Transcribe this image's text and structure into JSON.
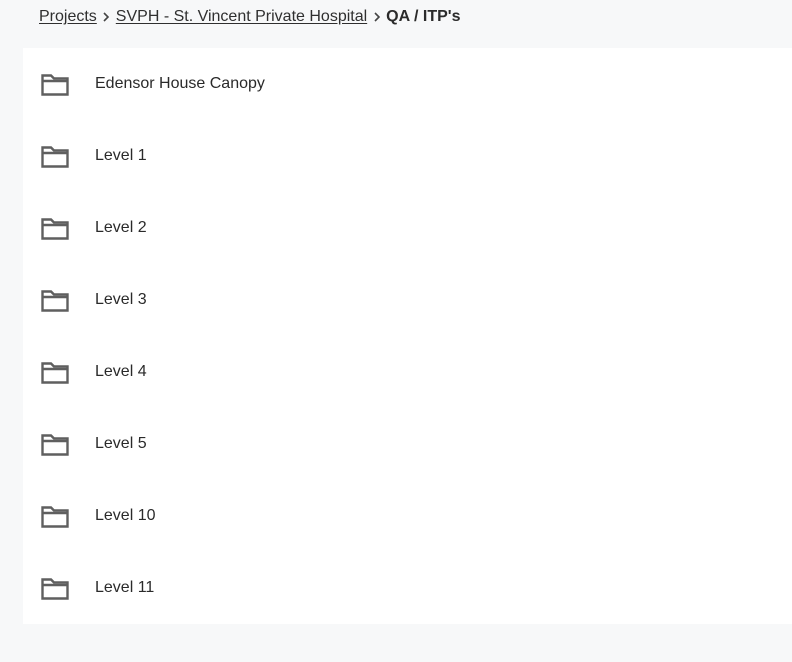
{
  "breadcrumb": {
    "items": [
      {
        "label": "Projects"
      },
      {
        "label": "SVPH - St. Vincent Private Hospital"
      }
    ],
    "current": "QA / ITP's",
    "separator_icon": "chevron-right-icon"
  },
  "folders": [
    {
      "label": "Edensor House Canopy",
      "icon": "folder-icon"
    },
    {
      "label": "Level 1",
      "icon": "folder-icon"
    },
    {
      "label": "Level 2",
      "icon": "folder-icon"
    },
    {
      "label": "Level 3",
      "icon": "folder-icon"
    },
    {
      "label": "Level 4",
      "icon": "folder-icon"
    },
    {
      "label": "Level 5",
      "icon": "folder-icon"
    },
    {
      "label": "Level 10",
      "icon": "folder-icon"
    },
    {
      "label": "Level 11",
      "icon": "folder-icon"
    }
  ],
  "colors": {
    "page_background": "#f7f8f9",
    "panel_background": "#ffffff",
    "icon_color": "#5f5f5f",
    "text_color": "#2a2a2a"
  }
}
